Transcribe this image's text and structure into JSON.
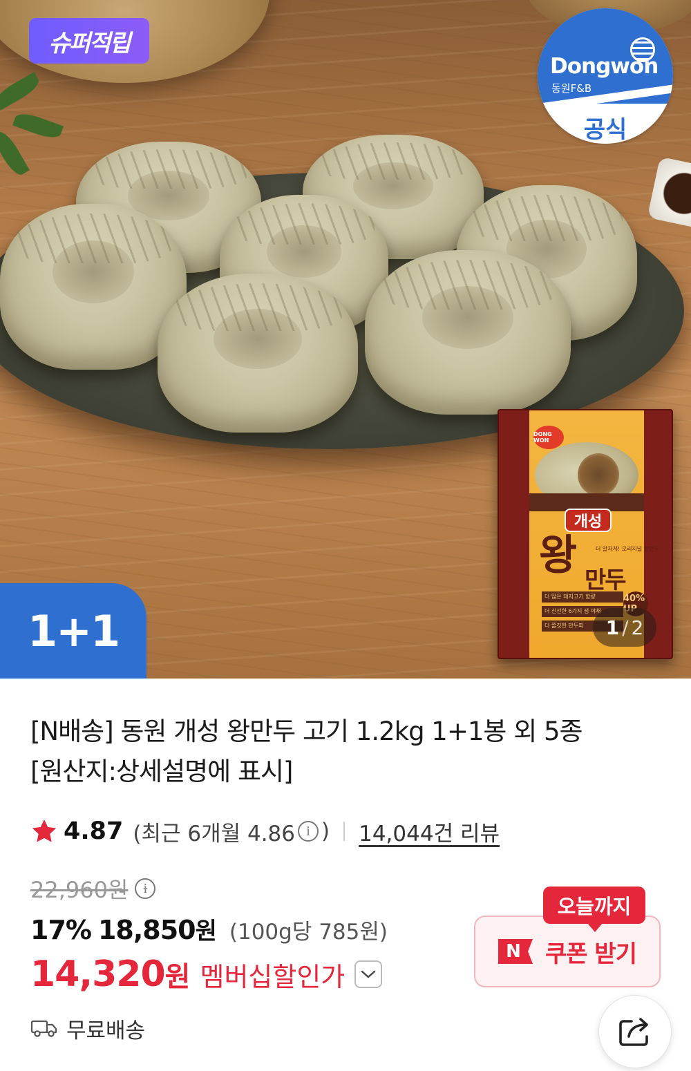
{
  "hero": {
    "badge_super": "슈퍼적립",
    "brand": {
      "name": "Dongwon",
      "sub": "동원F&B",
      "official": "공식"
    },
    "promo_tab": "1+1",
    "package": {
      "logo": "DONG WON",
      "kaesong": "개성",
      "wang": "왕",
      "mandu": "만두",
      "tagline": "더 알차게! 오리지널 왕만두",
      "lines": [
        "더 많은 돼지고기 함량",
        "더 신선한 6가지 생 야채",
        "더 쫄깃한 만두피"
      ],
      "badge": "40% UP"
    },
    "counter": {
      "current": "1",
      "separator": "/",
      "total": "2"
    }
  },
  "product": {
    "title_line1": "[N배송] 동원 개성 왕만두 고기 1.2kg 1+1봉 외 5종",
    "title_line2": "[원산지:상세설명에 표시]",
    "rating": "4.87",
    "recent_prefix": "(최근 6개월 4.86",
    "recent_suffix": ")",
    "review_count": "14,044건 리뷰",
    "original_price": "22,960원",
    "discount": "17%",
    "sale_price": "18,850",
    "sale_won": "원",
    "unit_price": "(100g당 785원)",
    "member_price": "14,320",
    "member_won": "원",
    "member_label": "멤버십할인가",
    "shipping": "무료배송"
  },
  "coupon": {
    "tag": "오늘까지",
    "n_logo": "N",
    "label": "쿠폰 받기"
  },
  "colors": {
    "accent_red": "#e5273c",
    "brand_blue": "#2f6fd0",
    "super_purple": "#7b5cfb"
  },
  "icons": {
    "star": "star-icon",
    "info": "info-icon",
    "chevron": "chevron-down-icon",
    "truck": "truck-icon",
    "share": "share-icon"
  }
}
